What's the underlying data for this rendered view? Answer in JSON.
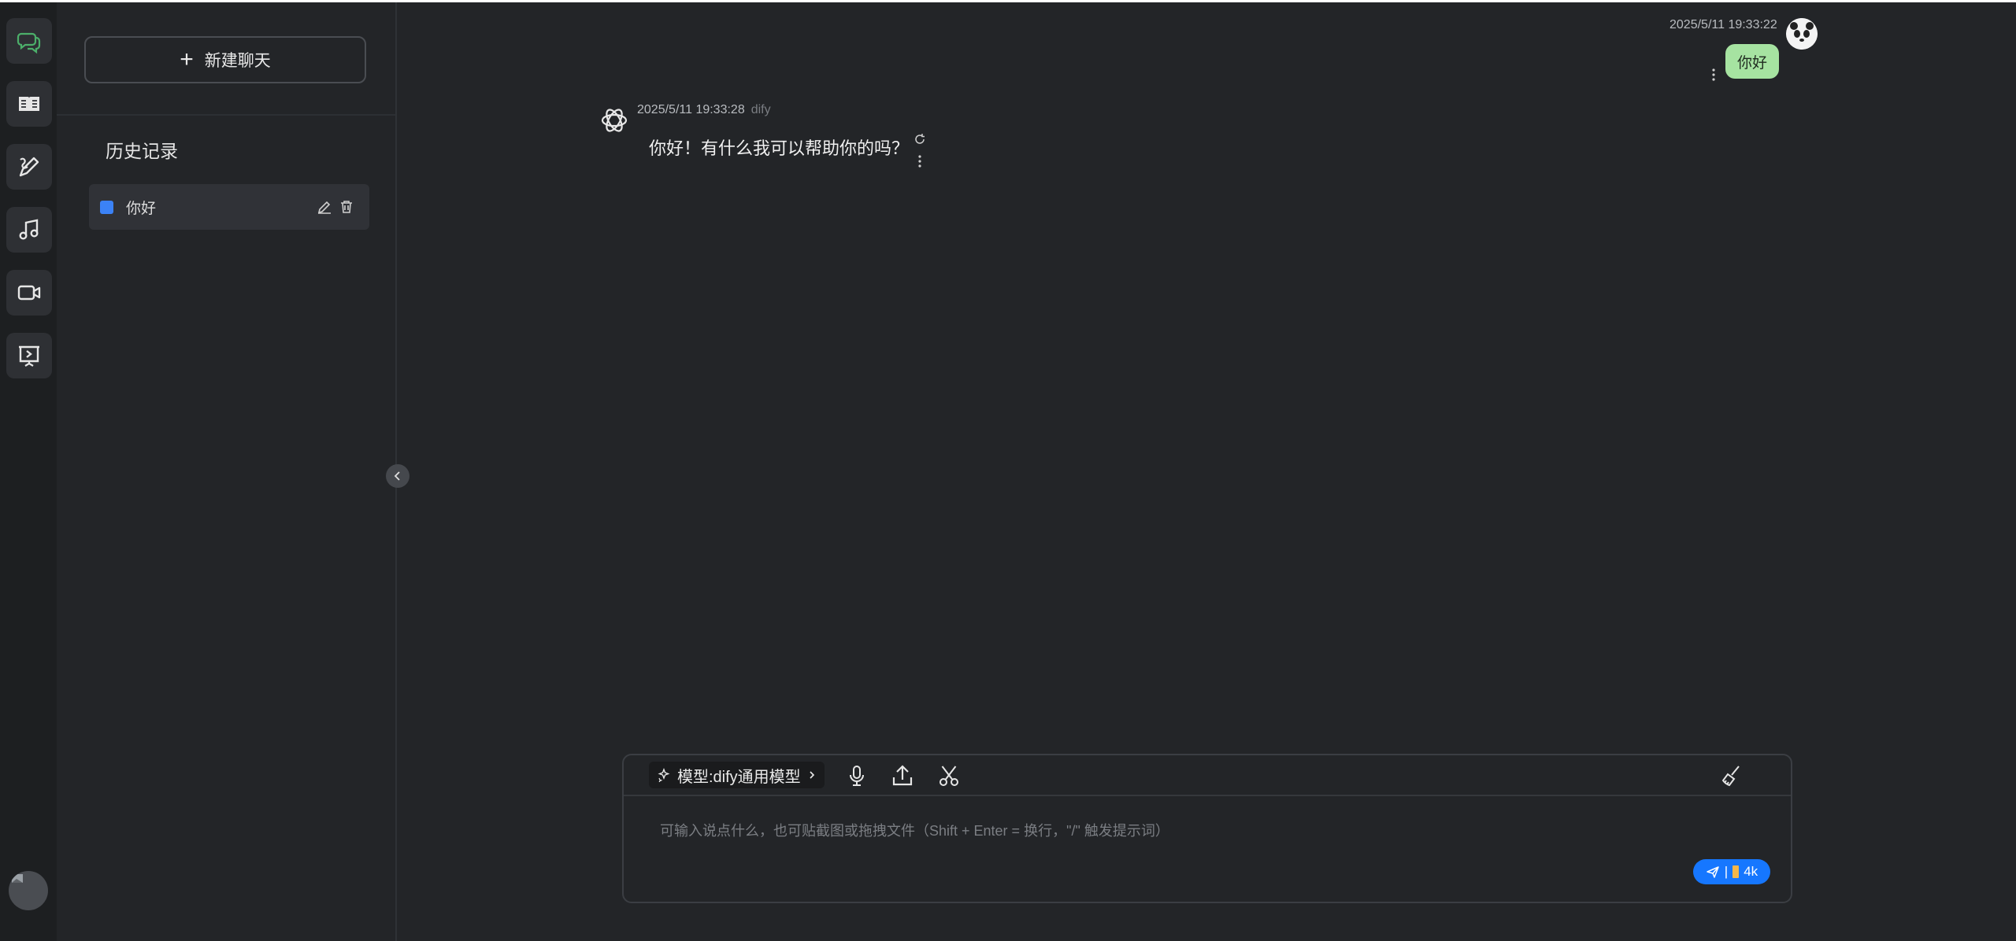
{
  "sidebar": {
    "rail": [
      {
        "icon": "chat-icon"
      },
      {
        "icon": "book-icon"
      },
      {
        "icon": "pen-icon"
      },
      {
        "icon": "music-icon"
      },
      {
        "icon": "video-icon"
      },
      {
        "icon": "presentation-icon"
      }
    ],
    "accent": "#4caf6a"
  },
  "panel": {
    "new_chat_label": "新建聊天",
    "history_title": "历史记录",
    "items": [
      {
        "title": "你好"
      }
    ]
  },
  "chat": {
    "user": {
      "time": "2025/5/11 19:33:22",
      "text": "你好",
      "bubble_color": "#a6e3a1"
    },
    "bot": {
      "time": "2025/5/11 19:33:28",
      "source": "dify",
      "text": "你好！有什么我可以帮助你的吗？"
    }
  },
  "composer": {
    "model_label": "模型:dify通用模型",
    "placeholder": "可输入说点什么，也可贴截图或拖拽文件（Shift + Enter = 换行，\"/\" 触发提示词）",
    "send_label": "4k",
    "send_color": "#1677ff"
  }
}
